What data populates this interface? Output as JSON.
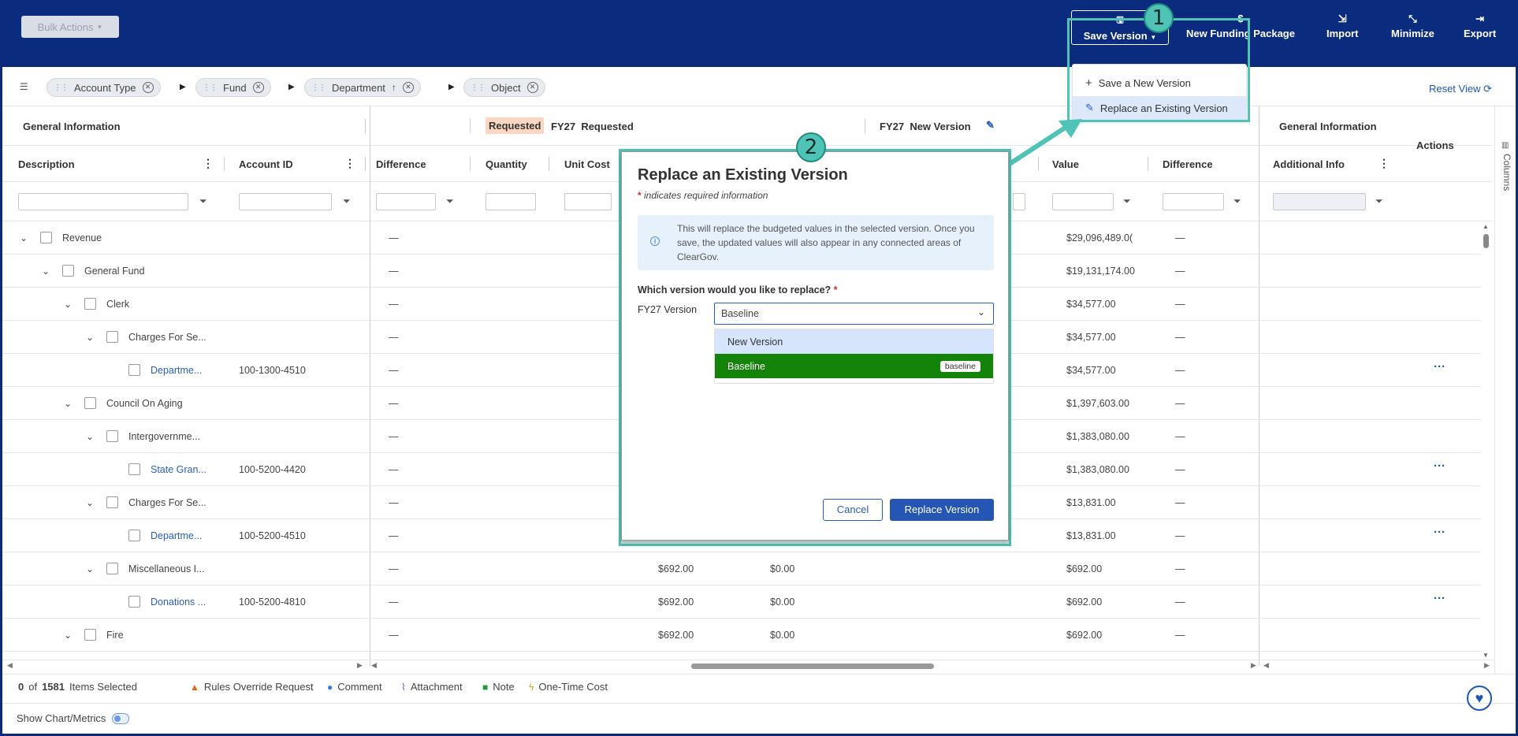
{
  "toolbar": {
    "bulk_actions": "Bulk Actions",
    "save_version": "Save Version",
    "new_funding_package": "New Funding Package",
    "import": "Import",
    "minimize": "Minimize",
    "export": "Export"
  },
  "save_menu": {
    "items": [
      {
        "label": "Save a New Version"
      },
      {
        "label": "Replace an Existing Version"
      }
    ]
  },
  "groupings": {
    "chips": [
      "Account Type",
      "Fund",
      "Department",
      "Object"
    ],
    "reset_view": "Reset View"
  },
  "column_groups": {
    "general_information": "General Information",
    "requested_tag": "Requested",
    "fy27_requested_year": "FY27",
    "fy27_requested": "Requested",
    "fy27_new_version_year": "FY27",
    "fy27_new_version": "New Version",
    "general_information_right": "General Information",
    "actions": "Actions"
  },
  "columns": {
    "description": "Description",
    "account_id": "Account ID",
    "difference": "Difference",
    "quantity": "Quantity",
    "unit_cost": "Unit Cost",
    "value": "Value",
    "difference_right": "Difference",
    "additional_info": "Additional Info"
  },
  "rows": [
    {
      "label": "Revenue",
      "account": "",
      "diff": "—",
      "c1": "",
      "c2": "",
      "value": "$29,096,489.0(",
      "diff2": "—",
      "link": false,
      "actions": false
    },
    {
      "label": "General Fund",
      "account": "",
      "diff": "—",
      "c1": "",
      "c2": "",
      "value": "$19,131,174.00",
      "diff2": "—",
      "link": false,
      "actions": false
    },
    {
      "label": "Clerk",
      "account": "",
      "diff": "—",
      "c1": "",
      "c2": "",
      "value": "$34,577.00",
      "diff2": "—",
      "link": false,
      "actions": false
    },
    {
      "label": "Charges For Se...",
      "account": "",
      "diff": "—",
      "c1": "",
      "c2": "",
      "value": "$34,577.00",
      "diff2": "—",
      "link": false,
      "actions": false
    },
    {
      "label": "Departme...",
      "account": "100-1300-4510",
      "diff": "—",
      "c1": "",
      "c2": "",
      "value": "$34,577.00",
      "diff2": "—",
      "link": true,
      "actions": true
    },
    {
      "label": "Council On Aging",
      "account": "",
      "diff": "—",
      "c1": "",
      "c2": "",
      "value": "$1,397,603.00",
      "diff2": "—",
      "link": false,
      "actions": false
    },
    {
      "label": "Intergovernme...",
      "account": "",
      "diff": "—",
      "c1": "",
      "c2": "",
      "value": "$1,383,080.00",
      "diff2": "—",
      "link": false,
      "actions": false
    },
    {
      "label": "State Gran...",
      "account": "100-5200-4420",
      "diff": "—",
      "c1": "",
      "c2": "",
      "value": "$1,383,080.00",
      "diff2": "—",
      "link": true,
      "actions": true
    },
    {
      "label": "Charges For Se...",
      "account": "",
      "diff": "—",
      "c1": "",
      "c2": "",
      "value": "$13,831.00",
      "diff2": "—",
      "link": false,
      "actions": false
    },
    {
      "label": "Departme...",
      "account": "100-5200-4510",
      "diff": "—",
      "c1": "",
      "c2": "",
      "value": "$13,831.00",
      "diff2": "—",
      "link": true,
      "actions": true
    },
    {
      "label": "Miscellaneous I...",
      "account": "",
      "diff": "—",
      "c1": "$692.00",
      "c2": "$0.00",
      "value": "$692.00",
      "diff2": "—",
      "link": false,
      "actions": false
    },
    {
      "label": "Donations ...",
      "account": "100-5200-4810",
      "diff": "—",
      "c1": "$692.00",
      "c2": "$0.00",
      "value": "$692.00",
      "diff2": "—",
      "link": true,
      "actions": true
    },
    {
      "label": "Fire",
      "account": "",
      "diff": "—",
      "c1": "$692.00",
      "c2": "$0.00",
      "value": "$692.00",
      "diff2": "—",
      "link": false,
      "actions": false
    }
  ],
  "footer": {
    "selected_count": "0",
    "of": "of",
    "total": "1581",
    "items_selected": "Items Selected",
    "legend": [
      "Rules Override Request",
      "Comment",
      "Attachment",
      "Note",
      "One-Time Cost"
    ],
    "show_chart": "Show Chart/Metrics"
  },
  "side_panel": {
    "columns": "Columns"
  },
  "modal": {
    "title": "Replace an Existing Version",
    "required_note": "indicates required information",
    "info": "This will replace the budgeted values in the selected version. Once you save, the updated values will also appear in any connected areas of ClearGov.",
    "question": "Which version would you like to replace?",
    "field_label": "FY27 Version",
    "selected_value": "Baseline",
    "options": [
      {
        "label": "New Version",
        "tag": ""
      },
      {
        "label": "Baseline",
        "tag": "baseline"
      }
    ],
    "cancel": "Cancel",
    "replace": "Replace Version"
  },
  "annotations": {
    "step1": "1",
    "step2": "2"
  }
}
